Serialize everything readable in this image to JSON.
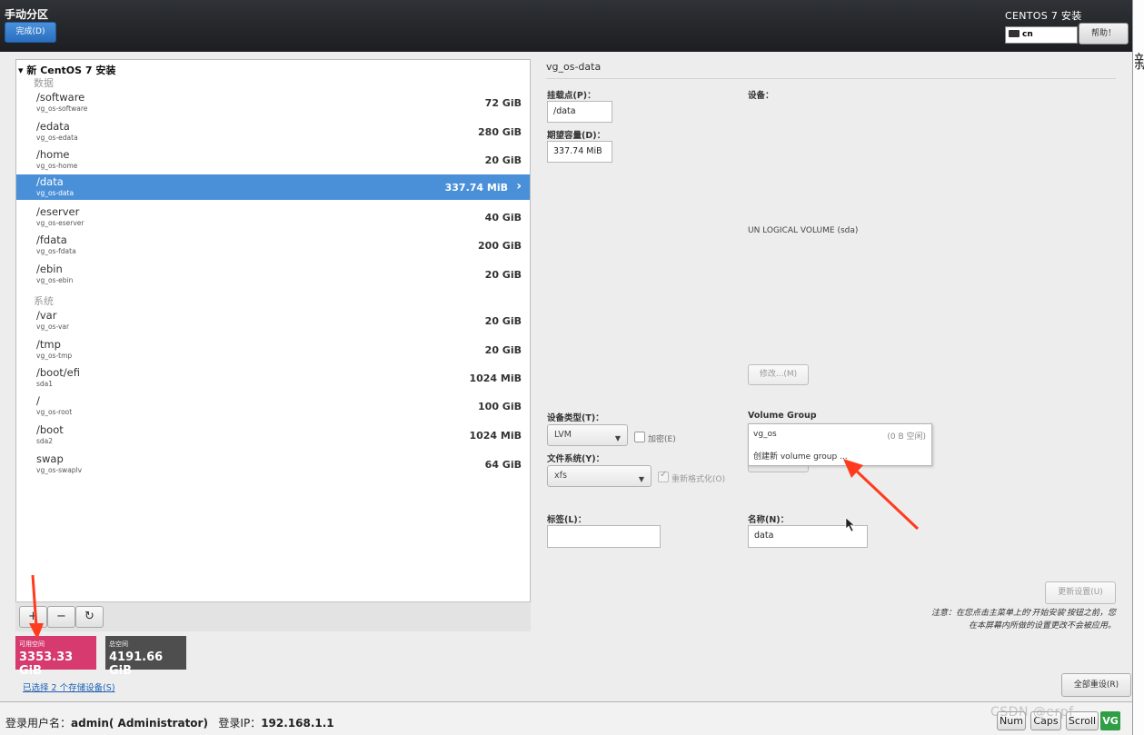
{
  "header": {
    "title": "手动分区",
    "done_label": "完成(D)",
    "product": "CENTOS 7 安装",
    "keyboard_layout": "cn",
    "help_label": "帮助！"
  },
  "side_glyph": "新",
  "tree": {
    "root_label": "新 CentOS 7 安装",
    "data_section": "数据",
    "system_section": "系统",
    "data_items": [
      {
        "mount": "/software",
        "device": "vg_os-software",
        "size": "72 GiB"
      },
      {
        "mount": "/edata",
        "device": "vg_os-edata",
        "size": "280 GiB"
      },
      {
        "mount": "/home",
        "device": "vg_os-home",
        "size": "20 GiB"
      },
      {
        "mount": "/data",
        "device": "vg_os-data",
        "size": "337.74 MiB"
      },
      {
        "mount": "/eserver",
        "device": "vg_os-eserver",
        "size": "40 GiB"
      },
      {
        "mount": "/fdata",
        "device": "vg_os-fdata",
        "size": "200 GiB"
      },
      {
        "mount": "/ebin",
        "device": "vg_os-ebin",
        "size": "20 GiB"
      }
    ],
    "system_items": [
      {
        "mount": "/var",
        "device": "vg_os-var",
        "size": "20 GiB"
      },
      {
        "mount": "/tmp",
        "device": "vg_os-tmp",
        "size": "20 GiB"
      },
      {
        "mount": "/boot/efi",
        "device": "sda1",
        "size": "1024 MiB"
      },
      {
        "mount": "/",
        "device": "vg_os-root",
        "size": "100 GiB"
      },
      {
        "mount": "/boot",
        "device": "sda2",
        "size": "1024 MiB"
      },
      {
        "mount": "swap",
        "device": "vg_os-swaplv",
        "size": "64 GiB"
      }
    ]
  },
  "toolbar": {
    "add": "+",
    "remove": "−",
    "refresh": "↻"
  },
  "space": {
    "available_label": "可用空间",
    "available_value": "3353.33 GiB",
    "total_label": "总空间",
    "total_value": "4191.66 GiB"
  },
  "storage_link": "已选择 2 个存储设备(S)",
  "detail": {
    "title": "vg_os-data",
    "mount_point_label": "挂载点(P)：",
    "mount_point_value": "/data",
    "capacity_label": "期望容量(D)：",
    "capacity_value": "337.74 MiB",
    "device_label": "设备：",
    "device_text": "UN LOGICAL VOLUME (sda)",
    "modify_label": "修改...(M)",
    "device_type_label": "设备类型(T)：",
    "device_type_value": "LVM",
    "encrypt_label": "加密(E)",
    "filesystem_label": "文件系统(Y)：",
    "filesystem_value": "xfs",
    "reformat_label": "重新格式化(O)",
    "volume_group_label": "Volume Group",
    "vg_option_name": "vg_os",
    "vg_option_free": "(0 B 空闲)",
    "vg_create_label": "创建新 volume group ...",
    "tag_label": "标签(L)：",
    "tag_value": "",
    "name_label": "名称(N)：",
    "name_value": "data",
    "update_label": "更新设置(U)",
    "note_line1": "注意：在您点击主菜单上的'开始安装'按钮之前，您",
    "note_line2": "在本屏幕内所做的设置更改不会被应用。",
    "reset_label": "全部重设(R)"
  },
  "footer": {
    "user_label": "登录用户名：",
    "user_value": "admin( Administrator)",
    "ip_label": "登录IP：",
    "ip_value": "192.168.1.1",
    "num_label": "Num",
    "caps_label": "Caps",
    "scroll_label": "Scroll",
    "watermark": "CSDN @erpf",
    "logo_text": "VG"
  },
  "colors": {
    "selected_row": "#4a90d9",
    "available_space": "#d63a6f",
    "total_space": "#4e4e4e",
    "annotation_arrow": "#ff3b1f"
  }
}
